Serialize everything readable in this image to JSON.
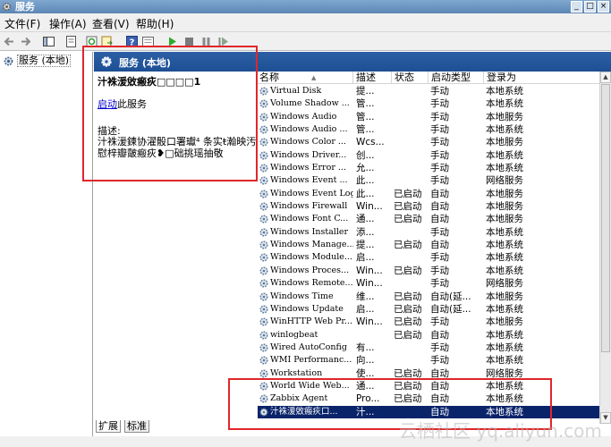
{
  "window": {
    "title": "服务",
    "controls": [
      "_",
      "□",
      "×"
    ]
  },
  "menu": [
    "文件(F)",
    "操作(A)",
    "查看(V)",
    "帮助(H)"
  ],
  "toolbar_icons": [
    "back-icon",
    "forward-icon",
    "show-hide-tree-icon",
    "properties-icon",
    "refresh-icon",
    "export-icon",
    "help-icon",
    "view-icon",
    "start-icon",
    "stop-icon",
    "pause-icon",
    "restart-icon"
  ],
  "tree": {
    "node": "服务 (本地)"
  },
  "header": {
    "title": "服务 (本地)"
  },
  "detail": {
    "service_name": "汁袾湲敓瘢疢□□□□1",
    "start_link": "启动",
    "start_suffix": "此服务",
    "desc_label": "描述:",
    "desc_text": "汁袾湲鍊协濯骰口署瓛⁴ 条实ŧ瀚映汚慰梓瓣皾瘢疢❥□础挑瑶抽敬"
  },
  "columns": [
    "名称",
    "描述",
    "状态",
    "启动类型",
    "登录为"
  ],
  "rows": [
    [
      "Virtual Disk",
      "提...",
      "",
      "手动",
      "本地系统"
    ],
    [
      "Volume Shadow ...",
      "管...",
      "",
      "手动",
      "本地系统"
    ],
    [
      "Windows Audio",
      "管...",
      "",
      "手动",
      "本地服务"
    ],
    [
      "Windows Audio ...",
      "管...",
      "",
      "手动",
      "本地系统"
    ],
    [
      "Windows Color ...",
      "Wcs...",
      "",
      "手动",
      "本地服务"
    ],
    [
      "Windows Driver...",
      "创...",
      "",
      "手动",
      "本地系统"
    ],
    [
      "Windows Error ...",
      "允...",
      "",
      "手动",
      "本地系统"
    ],
    [
      "Windows Event ...",
      "此...",
      "",
      "手动",
      "网络服务"
    ],
    [
      "Windows Event Log",
      "此...",
      "已启动",
      "自动",
      "本地服务"
    ],
    [
      "Windows Firewall",
      "Win...",
      "已启动",
      "自动",
      "本地服务"
    ],
    [
      "Windows Font C...",
      "通...",
      "已启动",
      "自动",
      "本地服务"
    ],
    [
      "Windows Installer",
      "添...",
      "",
      "手动",
      "本地系统"
    ],
    [
      "Windows Manage...",
      "提...",
      "已启动",
      "自动",
      "本地系统"
    ],
    [
      "Windows Module...",
      "启...",
      "",
      "手动",
      "本地系统"
    ],
    [
      "Windows Proces...",
      "Win...",
      "已启动",
      "手动",
      "本地系统"
    ],
    [
      "Windows Remote...",
      "Win...",
      "",
      "手动",
      "网络服务"
    ],
    [
      "Windows Time",
      "维...",
      "已启动",
      "自动(延...",
      "本地服务"
    ],
    [
      "Windows Update",
      "启...",
      "已启动",
      "自动(延...",
      "本地系统"
    ],
    [
      "WinHTTP Web Pr...",
      "Win...",
      "已启动",
      "手动",
      "本地服务"
    ],
    [
      "winlogbeat",
      "",
      "已启动",
      "自动",
      "本地系统"
    ],
    [
      "Wired AutoConfig",
      "有...",
      "",
      "手动",
      "本地系统"
    ],
    [
      "WMI Performanc...",
      "向...",
      "",
      "手动",
      "本地系统"
    ],
    [
      "Workstation",
      "使...",
      "已启动",
      "自动",
      "网络服务"
    ],
    [
      "World Wide Web...",
      "通...",
      "已启动",
      "自动",
      "本地系统"
    ],
    [
      "Zabbix Agent",
      "Pro...",
      "已启动",
      "自动",
      "本地系统"
    ],
    [
      "汁袾湲敓瘢疢口...",
      "汁...",
      "",
      "自动",
      "本地系统"
    ]
  ],
  "selected_row": 25,
  "tabs": [
    "扩展",
    "标准"
  ],
  "watermark": "云栖社区 yq.aliyun.com",
  "colors": {
    "header_bg": "#1d4f94",
    "selection": "#0a246a",
    "highlight_box": "#e0262b",
    "link": "#0000cc"
  }
}
